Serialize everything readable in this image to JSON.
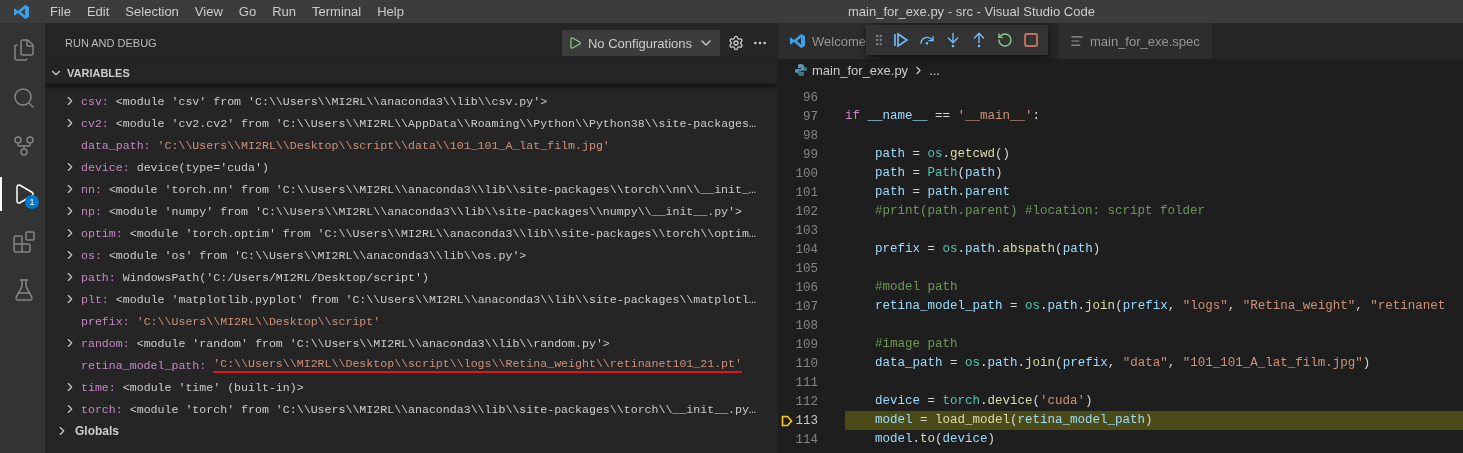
{
  "window": {
    "title": "main_for_exe.py - src - Visual Studio Code"
  },
  "menu": [
    "File",
    "Edit",
    "Selection",
    "View",
    "Go",
    "Run",
    "Terminal",
    "Help"
  ],
  "activity_bar": [
    {
      "kind": "explorer",
      "selected": false
    },
    {
      "kind": "search",
      "selected": false
    },
    {
      "kind": "source_control",
      "selected": false
    },
    {
      "kind": "debug",
      "selected": true,
      "badge": "1"
    },
    {
      "kind": "extensions",
      "selected": false
    },
    {
      "kind": "testing",
      "selected": false
    }
  ],
  "run_panel": {
    "title": "RUN AND DEBUG",
    "configuration": "No Configurations",
    "section": {
      "label": "VARIABLES",
      "expanded": true
    },
    "variables": [
      {
        "name": "csv:",
        "value": "<module 'csv' from 'C:\\\\Users\\\\MI2RL\\\\anaconda3\\\\lib\\\\csv.py'>",
        "kind": "object",
        "expandable": true,
        "underlined": false
      },
      {
        "name": "cv2:",
        "value": "<module 'cv2.cv2' from 'C:\\\\Users\\\\MI2RL\\\\AppData\\\\Roaming\\\\Python\\\\Python38\\\\site-packages…",
        "kind": "object",
        "expandable": true,
        "underlined": false
      },
      {
        "name": "data_path:",
        "value": "'C:\\\\Users\\\\MI2RL\\\\Desktop\\\\script\\\\data\\\\101_101_A_lat_film.jpg'",
        "kind": "string",
        "expandable": false,
        "underlined": false
      },
      {
        "name": "device:",
        "value": "device(type='cuda')",
        "kind": "object",
        "expandable": true,
        "underlined": false
      },
      {
        "name": "nn:",
        "value": "<module 'torch.nn' from 'C:\\\\Users\\\\MI2RL\\\\anaconda3\\\\lib\\\\site-packages\\\\torch\\\\nn\\\\__init_…",
        "kind": "object",
        "expandable": true,
        "underlined": false
      },
      {
        "name": "np:",
        "value": "<module 'numpy' from 'C:\\\\Users\\\\MI2RL\\\\anaconda3\\\\lib\\\\site-packages\\\\numpy\\\\__init__.py'>",
        "kind": "object",
        "expandable": true,
        "underlined": false
      },
      {
        "name": "optim:",
        "value": "<module 'torch.optim' from 'C:\\\\Users\\\\MI2RL\\\\anaconda3\\\\lib\\\\site-packages\\\\torch\\\\optim…",
        "kind": "object",
        "expandable": true,
        "underlined": false
      },
      {
        "name": "os:",
        "value": "<module 'os' from 'C:\\\\Users\\\\MI2RL\\\\anaconda3\\\\lib\\\\os.py'>",
        "kind": "object",
        "expandable": true,
        "underlined": false
      },
      {
        "name": "path:",
        "value": "WindowsPath('C:/Users/MI2RL/Desktop/script')",
        "kind": "object",
        "expandable": true,
        "underlined": false
      },
      {
        "name": "plt:",
        "value": "<module 'matplotlib.pyplot' from 'C:\\\\Users\\\\MI2RL\\\\anaconda3\\\\lib\\\\site-packages\\\\matplotl…",
        "kind": "object",
        "expandable": true,
        "underlined": false
      },
      {
        "name": "prefix:",
        "value": "'C:\\\\Users\\\\MI2RL\\\\Desktop\\\\script'",
        "kind": "string",
        "expandable": false,
        "underlined": false
      },
      {
        "name": "random:",
        "value": "<module 'random' from 'C:\\\\Users\\\\MI2RL\\\\anaconda3\\\\lib\\\\random.py'>",
        "kind": "object",
        "expandable": true,
        "underlined": false
      },
      {
        "name": "retina_model_path:",
        "value": "'C:\\\\Users\\\\MI2RL\\\\Desktop\\\\script\\\\logs\\\\Retina_weight\\\\retinanet101_21.pt'",
        "kind": "string",
        "expandable": false,
        "underlined": true
      },
      {
        "name": "time:",
        "value": "<module 'time' (built-in)>",
        "kind": "object",
        "expandable": true,
        "underlined": false
      },
      {
        "name": "torch:",
        "value": "<module 'torch' from 'C:\\\\Users\\\\MI2RL\\\\anaconda3\\\\lib\\\\site-packages\\\\torch\\\\__init__.py…",
        "kind": "object",
        "expandable": true,
        "underlined": false
      }
    ],
    "globals": {
      "label": "Globals",
      "expanded": false
    }
  },
  "editor": {
    "tabs": [
      {
        "label": "Welcome",
        "kind": "welcome"
      },
      {
        "label": "main_for_exe.spec",
        "kind": "spec"
      }
    ],
    "debug_toolbar": [
      {
        "kind": "continue"
      },
      {
        "kind": "step_over"
      },
      {
        "kind": "step_into"
      },
      {
        "kind": "step_out"
      },
      {
        "kind": "restart"
      },
      {
        "kind": "stop"
      }
    ],
    "breadcrumb": [
      "main_for_exe.py",
      "..."
    ],
    "lines": [
      {
        "number": "96",
        "current": false
      },
      {
        "number": "97",
        "current": false,
        "indented": false,
        "tokens": [
          {
            "kw": "if"
          },
          {
            "v": " __name__"
          },
          {
            "p": " == "
          },
          {
            "s": "'__main__'"
          },
          {
            "p": ":"
          }
        ]
      },
      {
        "number": "98",
        "current": false
      },
      {
        "number": "99",
        "current": false,
        "indented": true,
        "tokens": [
          {
            "v": "path"
          },
          {
            "p": " = "
          },
          {
            "c": "os"
          },
          {
            "p": "."
          },
          {
            "f": "getcwd"
          },
          {
            "p": "()"
          }
        ]
      },
      {
        "number": "100",
        "current": false,
        "indented": true,
        "tokens": [
          {
            "v": "path"
          },
          {
            "p": " = "
          },
          {
            "c": "Path"
          },
          {
            "p": "("
          },
          {
            "v": "path"
          },
          {
            "p": ")"
          }
        ]
      },
      {
        "number": "101",
        "current": false,
        "indented": true,
        "tokens": [
          {
            "v": "path"
          },
          {
            "p": " = "
          },
          {
            "v": "path"
          },
          {
            "p": "."
          },
          {
            "v": "parent"
          }
        ]
      },
      {
        "number": "102",
        "current": false,
        "indented": true,
        "tokens": [
          {
            "m": "#print(path.parent) #location: script folder"
          }
        ]
      },
      {
        "number": "103",
        "current": false
      },
      {
        "number": "104",
        "current": false,
        "indented": true,
        "tokens": [
          {
            "v": "prefix"
          },
          {
            "p": " = "
          },
          {
            "c": "os"
          },
          {
            "p": "."
          },
          {
            "v": "path"
          },
          {
            "p": "."
          },
          {
            "f": "abspath"
          },
          {
            "p": "("
          },
          {
            "v": "path"
          },
          {
            "p": ")"
          }
        ]
      },
      {
        "number": "105",
        "current": false
      },
      {
        "number": "106",
        "current": false,
        "indented": true,
        "tokens": [
          {
            "m": "#model path"
          }
        ]
      },
      {
        "number": "107",
        "current": false,
        "indented": true,
        "tokens": [
          {
            "v": "retina_model_path"
          },
          {
            "p": " = "
          },
          {
            "c": "os"
          },
          {
            "p": "."
          },
          {
            "v": "path"
          },
          {
            "p": "."
          },
          {
            "f": "join"
          },
          {
            "p": "("
          },
          {
            "v": "prefix"
          },
          {
            "p": ", "
          },
          {
            "s": "\"logs\""
          },
          {
            "p": ", "
          },
          {
            "s": "\"Retina_weight\""
          },
          {
            "p": ", "
          },
          {
            "s": "\"retinanet"
          }
        ]
      },
      {
        "number": "108",
        "current": false
      },
      {
        "number": "109",
        "current": false,
        "indented": true,
        "tokens": [
          {
            "m": "#image path"
          }
        ]
      },
      {
        "number": "110",
        "current": false,
        "indented": true,
        "tokens": [
          {
            "v": "data_path"
          },
          {
            "p": " = "
          },
          {
            "c": "os"
          },
          {
            "p": "."
          },
          {
            "v": "path"
          },
          {
            "p": "."
          },
          {
            "f": "join"
          },
          {
            "p": "("
          },
          {
            "v": "prefix"
          },
          {
            "p": ", "
          },
          {
            "s": "\"data\""
          },
          {
            "p": ", "
          },
          {
            "s": "\"101_101_A_lat_film.jpg\""
          },
          {
            "p": ")"
          }
        ]
      },
      {
        "number": "111",
        "current": false
      },
      {
        "number": "112",
        "current": false,
        "indented": true,
        "tokens": [
          {
            "v": "device"
          },
          {
            "p": " = "
          },
          {
            "c": "torch"
          },
          {
            "p": "."
          },
          {
            "f": "device"
          },
          {
            "p": "("
          },
          {
            "s": "'cuda'"
          },
          {
            "p": ")"
          }
        ]
      },
      {
        "number": "113",
        "current": true,
        "indented": true,
        "tokens": [
          {
            "v": "model"
          },
          {
            "p": " = "
          },
          {
            "f": "load_model"
          },
          {
            "p": "("
          },
          {
            "v": "retina_model_path"
          },
          {
            "p": ")"
          }
        ]
      },
      {
        "number": "114",
        "current": false,
        "indented": true,
        "tokens": [
          {
            "v": "model"
          },
          {
            "p": "."
          },
          {
            "f": "to"
          },
          {
            "p": "("
          },
          {
            "v": "device"
          },
          {
            "p": ")"
          }
        ]
      }
    ]
  }
}
